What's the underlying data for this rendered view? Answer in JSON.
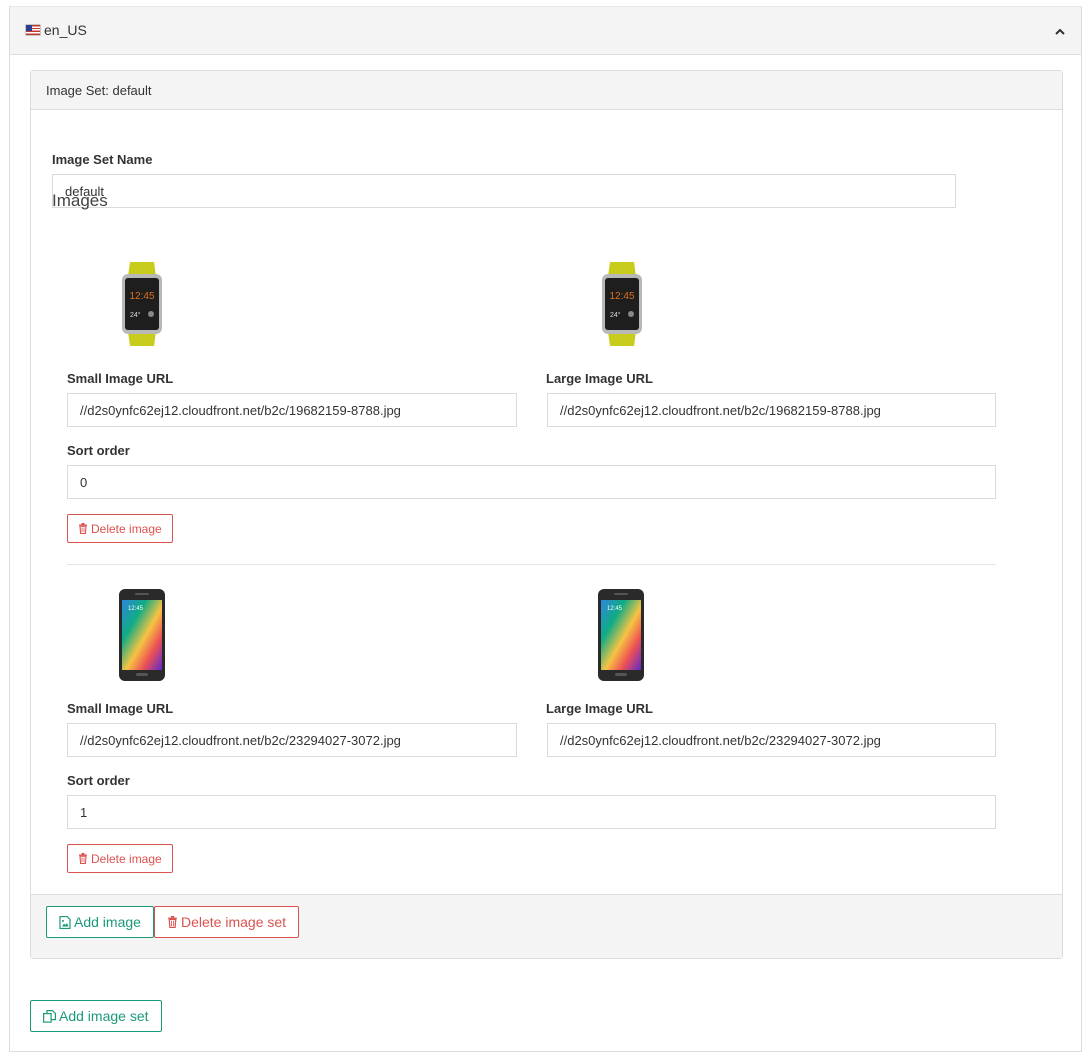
{
  "locale": {
    "label": "en_US",
    "flag_icon": "us-flag-icon",
    "toggle_icon": "chevron-up-icon"
  },
  "image_set": {
    "header": "Image Set: default",
    "name_label": "Image Set Name",
    "name_value": "default",
    "images_heading": "Images",
    "images": [
      {
        "thumbnail": "smartwatch-image",
        "small_label": "Small Image URL",
        "small_url": "//d2s0ynfc62ej12.cloudfront.net/b2c/19682159-8788.jpg",
        "large_label": "Large Image URL",
        "large_url": "//d2s0ynfc62ej12.cloudfront.net/b2c/19682159-8788.jpg",
        "sort_label": "Sort order",
        "sort_value": "0",
        "delete_label": "Delete image",
        "watch_time": "12:45",
        "watch_temp": "24°"
      },
      {
        "thumbnail": "smartphone-image",
        "small_label": "Small Image URL",
        "small_url": "//d2s0ynfc62ej12.cloudfront.net/b2c/23294027-3072.jpg",
        "large_label": "Large Image URL",
        "large_url": "//d2s0ynfc62ej12.cloudfront.net/b2c/23294027-3072.jpg",
        "sort_label": "Sort order",
        "sort_value": "1",
        "delete_label": "Delete image"
      }
    ],
    "add_image_label": "Add image",
    "delete_set_label": "Delete image set"
  },
  "add_image_set_label": "Add image set",
  "colors": {
    "danger": "#d9534f",
    "teal": "#1a9a7a",
    "panel_bg": "#f4f4f4",
    "border": "#dcdcdc"
  }
}
